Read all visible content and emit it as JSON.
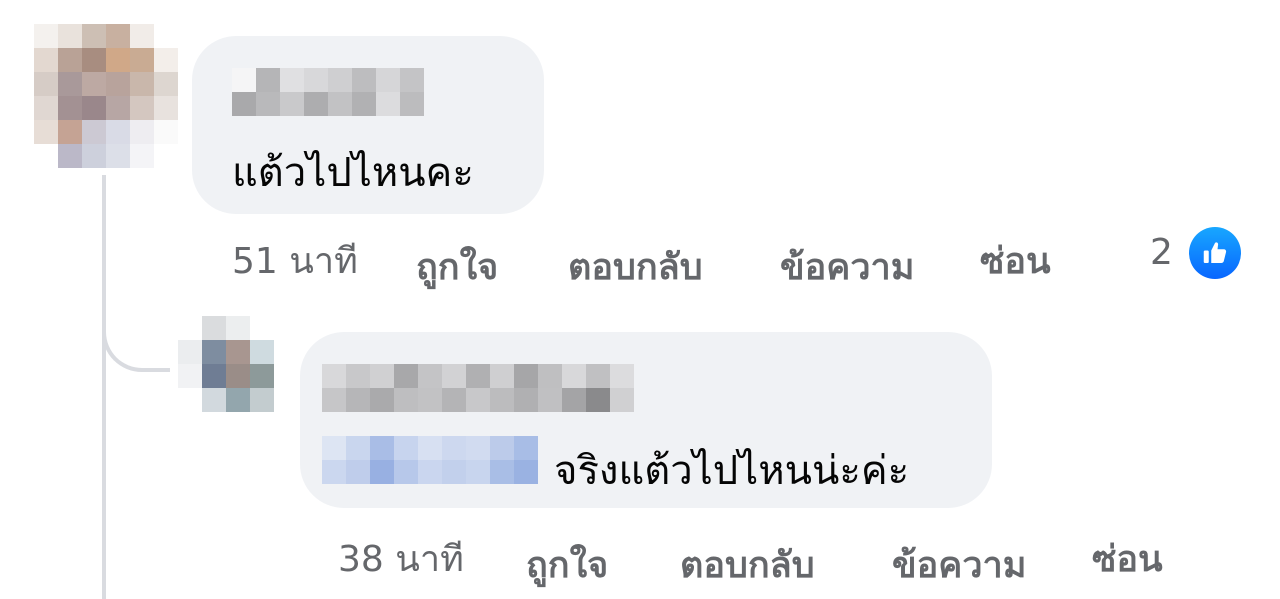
{
  "comments": [
    {
      "text": "แต้วไปไหนคะ",
      "time": "51 นาที",
      "like": "ถูกใจ",
      "reply": "ตอบกลับ",
      "message": "ข้อความ",
      "hide": "ซ่อน",
      "reaction_count": "2",
      "reaction_icon": "thumbs-up-icon"
    },
    {
      "text": "จริงแต้วไปไหนน่ะค่ะ",
      "time": "38 นาที",
      "like": "ถูกใจ",
      "reply": "ตอบกลับ",
      "message": "ข้อความ",
      "hide": "ซ่อน"
    }
  ],
  "colors": {
    "bubble": "#f0f2f5",
    "meta_text": "#65676b",
    "body_text": "#050505",
    "like_blue": "#0866ff",
    "thread_line": "#d9dbe0"
  }
}
